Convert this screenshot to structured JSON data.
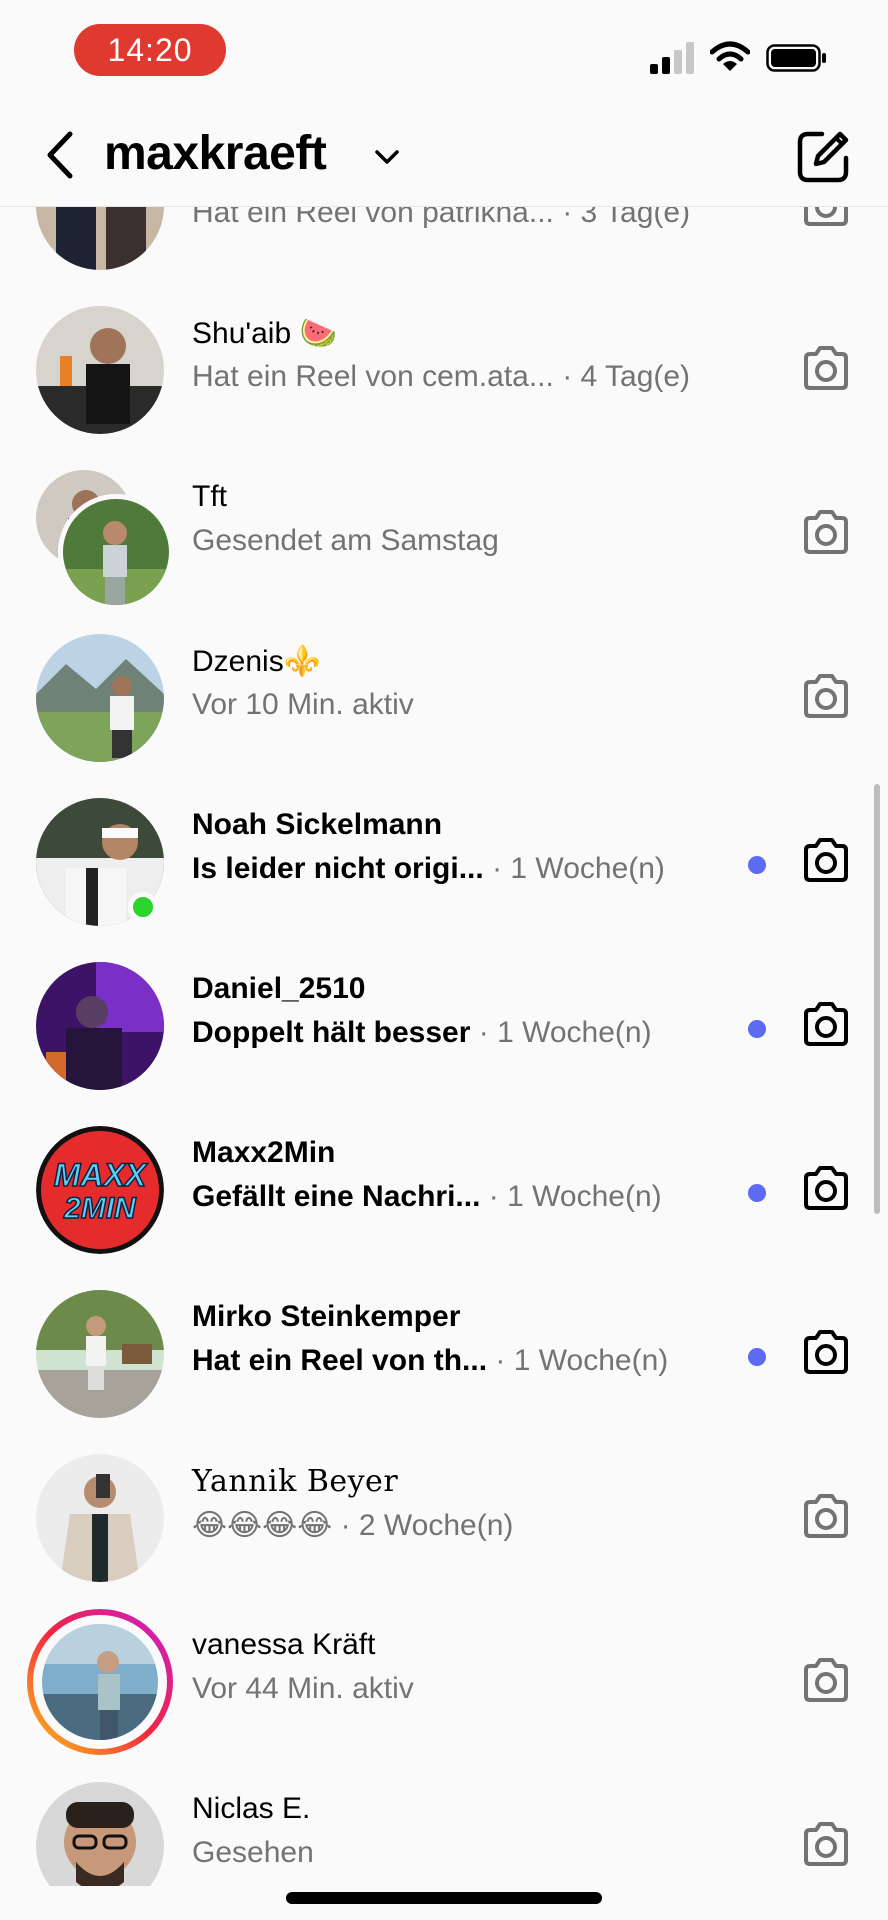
{
  "status": {
    "time": "14:20"
  },
  "header": {
    "username": "maxkraeft"
  },
  "threads": [
    {
      "name": "",
      "message": "Hat ein Reel von patrikha...",
      "time": "· 3 Tag(e)",
      "unread": false
    },
    {
      "name": "Shu'aib 🍉",
      "message": "Hat ein Reel von cem.ata...",
      "time": "· 4 Tag(e)",
      "unread": false
    },
    {
      "name": "Tft",
      "message": "Gesendet am Samstag",
      "time": "",
      "unread": false
    },
    {
      "name": "Dzenis⚜️",
      "message": "Vor 10 Min. aktiv",
      "time": "",
      "unread": false
    },
    {
      "name": "Noah Sickelmann",
      "message": "Is leider nicht origi...",
      "time": "· 1 Woche(n)",
      "unread": true
    },
    {
      "name": "Daniel_2510",
      "message": "Doppelt hält besser",
      "time": "· 1 Woche(n)",
      "unread": true
    },
    {
      "name": "Maxx2Min",
      "message": "Gefällt eine Nachri...",
      "time": "· 1 Woche(n)",
      "unread": true
    },
    {
      "name": "Mirko Steinkemper",
      "message": "Hat ein Reel von th...",
      "time": "· 1 Woche(n)",
      "unread": true
    },
    {
      "name": "Yannik Beyer",
      "message": "😂😂😂😂",
      "time": "· 2 Woche(n)",
      "unread": false
    },
    {
      "name": "vanessa Kräft",
      "message": "Vor 44 Min. aktiv",
      "time": "",
      "unread": false
    },
    {
      "name": "Niclas E.",
      "message": "Gesehen",
      "time": "",
      "unread": false
    }
  ],
  "maxx_logo": {
    "line1": "MAXX",
    "line2": "2MIN"
  },
  "icons": [
    "back-chevron",
    "dropdown-chevron",
    "compose",
    "camera",
    "signal",
    "wifi",
    "battery"
  ],
  "colors": {
    "unread_dot": "#5b6cf2",
    "online": "#2bd42b",
    "notif_dot": "#ff2436",
    "time_pill": "#e0392f"
  }
}
